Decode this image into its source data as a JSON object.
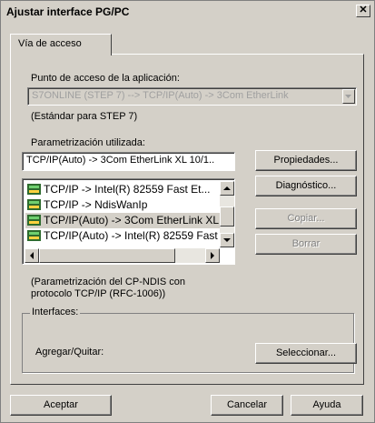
{
  "window": {
    "title": "Ajustar interface PG/PC",
    "close_label": "✕"
  },
  "tab": {
    "label": "Vía de acceso"
  },
  "access_point": {
    "label": "Punto de acceso de la aplicación:",
    "value": "S7ONLINE     (STEP 7)     --> TCP/IP(Auto) -> 3Com EtherLink",
    "note": "(Estándar para STEP 7)"
  },
  "param": {
    "label": "Parametrización utilizada:",
    "value": "TCP/IP(Auto) -> 3Com EtherLink XL 10/1..",
    "items": [
      {
        "label": "TCP/IP -> Intel(R) 82559 Fast Et..."
      },
      {
        "label": "TCP/IP -> NdisWanIp"
      },
      {
        "label": "TCP/IP(Auto) -> 3Com EtherLink XL"
      },
      {
        "label": "TCP/IP(Auto) -> Intel(R) 82559 Fast"
      }
    ],
    "description": "(Parametrización del CP-NDIS con\nprotocolo TCP/IP (RFC-1006))"
  },
  "buttons": {
    "properties": "Propiedades...",
    "diagnostics": "Diagnóstico...",
    "copy": "Copiar...",
    "delete": "Borrar",
    "select": "Seleccionar...",
    "accept": "Aceptar",
    "cancel": "Cancelar",
    "help": "Ayuda"
  },
  "interfaces": {
    "group_label": "Interfaces:",
    "add_remove_label": "Agregar/Quitar:"
  }
}
